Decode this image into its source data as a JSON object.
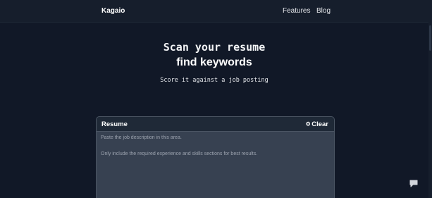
{
  "nav": {
    "brand": "Kagaio",
    "links": [
      "Features",
      "Blog"
    ]
  },
  "hero": {
    "line1": "Scan your resume",
    "line2": "find keywords",
    "subtitle": "Score it against a job posting"
  },
  "resume_card": {
    "title": "Resume",
    "clear_label": "Clear",
    "placeholder_lines": [
      "Paste the job description in this area.",
      "Only include the required experience and skills sections for best results."
    ]
  },
  "icons": {
    "clear": "eraser-icon",
    "chat": "chat-bubble-icon"
  },
  "colors": {
    "background": "#111827",
    "navbar": "#161e2c",
    "card": "#374151",
    "card_header": "#1f2937"
  }
}
